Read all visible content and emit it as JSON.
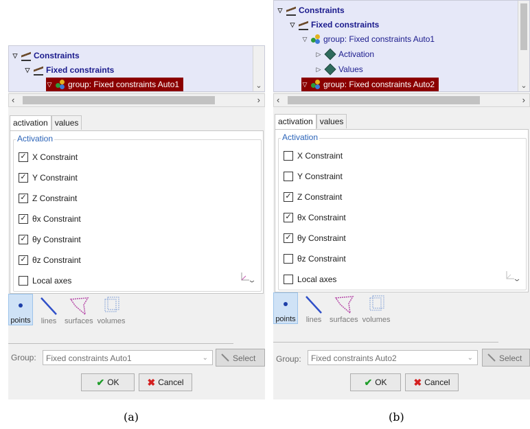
{
  "panel_a": {
    "tree": [
      {
        "label": "Constraints",
        "style": "bold",
        "icon": "constraint-icon"
      },
      {
        "label": "Fixed constraints",
        "style": "bold",
        "icon": "constraint-icon"
      },
      {
        "label": "group: Fixed constraints Auto1",
        "style": "selected",
        "icon": "group-icon"
      }
    ],
    "tabs": [
      "activation",
      "values"
    ],
    "group_title": "Activation",
    "checkboxes": [
      {
        "label": "X Constraint",
        "checked": true
      },
      {
        "label": "Y Constraint",
        "checked": true
      },
      {
        "label": "Z Constraint",
        "checked": true
      },
      {
        "label": "θx Constraint",
        "checked": true
      },
      {
        "label": "θy Constraint",
        "checked": true
      },
      {
        "label": "θz Constraint",
        "checked": true
      },
      {
        "label": "Local axes",
        "checked": false
      }
    ],
    "geometry": [
      "points",
      "lines",
      "surfaces",
      "volumes"
    ],
    "group_label": "Group:",
    "group_value": "Fixed constraints Auto1",
    "select_label": "Select",
    "ok_label": "OK",
    "cancel_label": "Cancel"
  },
  "panel_b": {
    "tree": [
      {
        "label": "Constraints",
        "style": "bold",
        "icon": "constraint-icon"
      },
      {
        "label": "Fixed constraints",
        "style": "bold",
        "icon": "constraint-icon"
      },
      {
        "label": "group: Fixed constraints Auto1",
        "style": "normal",
        "icon": "group-icon"
      },
      {
        "label": "Activation",
        "style": "normal",
        "icon": "cube-icon"
      },
      {
        "label": "Values",
        "style": "normal",
        "icon": "cube-icon"
      },
      {
        "label": "group: Fixed constraints Auto2",
        "style": "selected",
        "icon": "group-icon"
      }
    ],
    "tabs": [
      "activation",
      "values"
    ],
    "group_title": "Activation",
    "checkboxes": [
      {
        "label": "X Constraint",
        "checked": false
      },
      {
        "label": "Y Constraint",
        "checked": false
      },
      {
        "label": "Z Constraint",
        "checked": true
      },
      {
        "label": "θx Constraint",
        "checked": true
      },
      {
        "label": "θy Constraint",
        "checked": true
      },
      {
        "label": "θz Constraint",
        "checked": false
      },
      {
        "label": "Local axes",
        "checked": false
      }
    ],
    "geometry": [
      "points",
      "lines",
      "surfaces",
      "volumes"
    ],
    "group_label": "Group:",
    "group_value": "Fixed constraints Auto2",
    "select_label": "Select",
    "ok_label": "OK",
    "cancel_label": "Cancel"
  },
  "captions": {
    "a": "(a)",
    "b": "(b)"
  },
  "colors": {
    "selected_row": "#8b0000",
    "tree_bg": "#e6e8f8",
    "tree_text": "#1a1a8c",
    "group_title": "#2a63b8"
  }
}
